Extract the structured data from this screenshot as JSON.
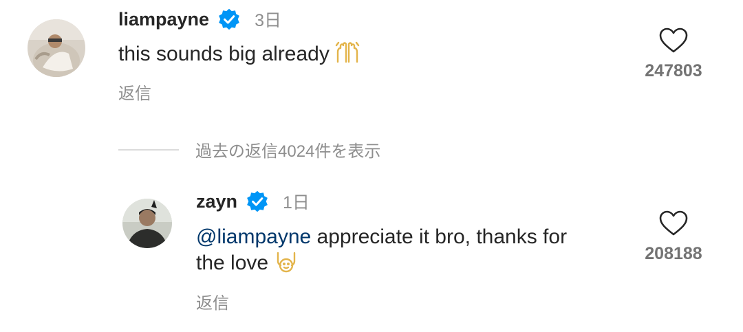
{
  "comments": [
    {
      "username": "liampayne",
      "timestamp": "3日",
      "text": "this sounds big already",
      "emoji": "raising-hands-icon",
      "reply_label": "返信",
      "likes": "247803"
    },
    {
      "username": "zayn",
      "timestamp": "1日",
      "mention": "@liampayne",
      "text_after_mention": " appreciate it bro, thanks for",
      "text_line2": "the love",
      "emoji": "raising-hands-outline-icon",
      "reply_label": "返信",
      "likes": "208188"
    }
  ],
  "view_replies_label": "過去の返信4024件を表示",
  "colors": {
    "text": "#262626",
    "muted": "#8e8e8e",
    "mention": "#00376b",
    "verified": "#0095f6",
    "emoji": "#e3b44a"
  }
}
